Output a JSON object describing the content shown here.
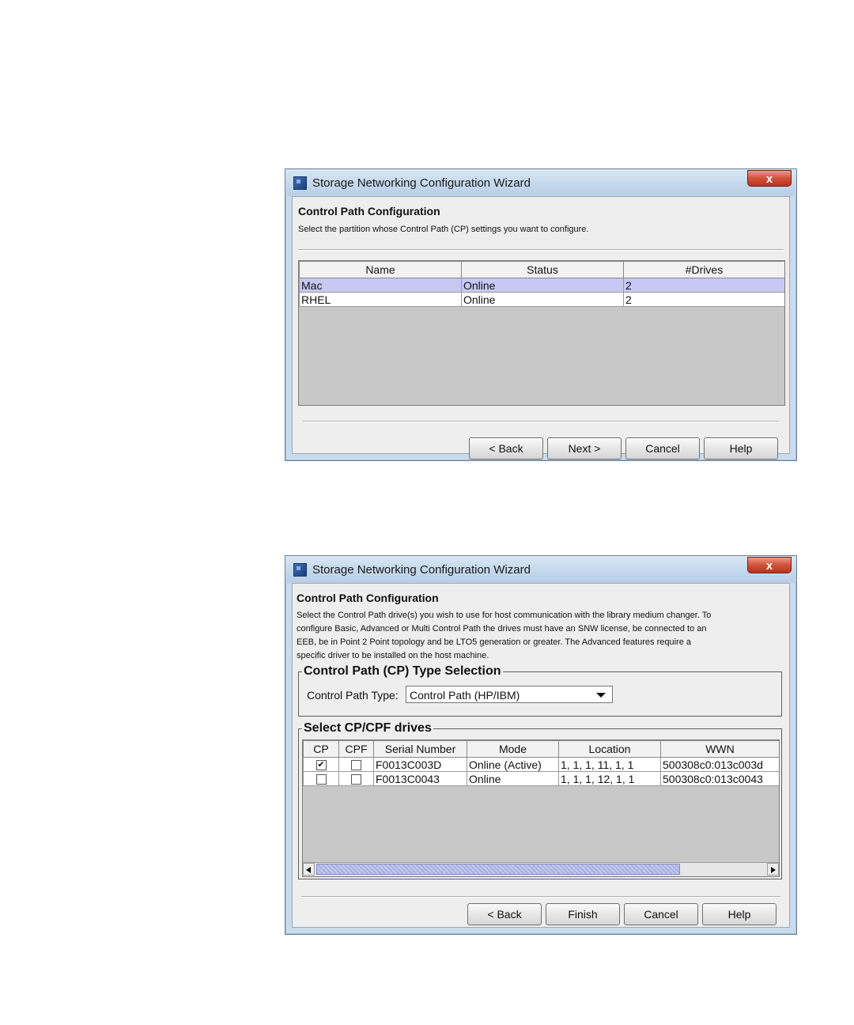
{
  "dialog1": {
    "window_title": "Storage Networking Configuration Wizard",
    "close_label": "x",
    "heading": "Control Path Configuration",
    "description": "Select the partition whose Control Path (CP) settings you want to configure.",
    "table": {
      "columns": [
        "Name",
        "Status",
        "#Drives"
      ],
      "rows": [
        {
          "name": "Mac",
          "status": "Online",
          "drives": "2",
          "selected": true
        },
        {
          "name": "RHEL",
          "status": "Online",
          "drives": "2",
          "selected": false
        }
      ]
    },
    "buttons": {
      "back": "< Back",
      "next": "Next >",
      "cancel": "Cancel",
      "help": "Help"
    }
  },
  "dialog2": {
    "window_title": "Storage Networking Configuration Wizard",
    "close_label": "x",
    "heading": "Control Path Configuration",
    "description_lines": [
      "Select the Control Path drive(s) you wish to use for host communication with the library medium changer. To",
      "configure Basic, Advanced or Multi Control Path the drives must have an SNW license, be connected to an",
      "EEB, be in Point 2 Point topology and be LTO5 generation or greater. The Advanced features require a",
      "specific driver to be installed on the host machine."
    ],
    "type_group": {
      "legend": "Control Path (CP) Type Selection",
      "label": "Control Path Type:",
      "selected": "Control Path (HP/IBM)"
    },
    "drives_group": {
      "legend": "Select CP/CPF drives",
      "columns": [
        "CP",
        "CPF",
        "Serial Number",
        "Mode",
        "Location",
        "WWN"
      ],
      "rows": [
        {
          "cp": true,
          "cpf": false,
          "serial": "F0013C003D",
          "mode": "Online (Active)",
          "location": "1, 1, 1, 11, 1, 1",
          "wwn": "500308c0:013c003d"
        },
        {
          "cp": false,
          "cpf": false,
          "serial": "F0013C0043",
          "mode": "Online",
          "location": "1, 1, 1, 12, 1, 1",
          "wwn": "500308c0:013c0043"
        }
      ]
    },
    "buttons": {
      "back": "< Back",
      "finish": "Finish",
      "cancel": "Cancel",
      "help": "Help"
    }
  }
}
